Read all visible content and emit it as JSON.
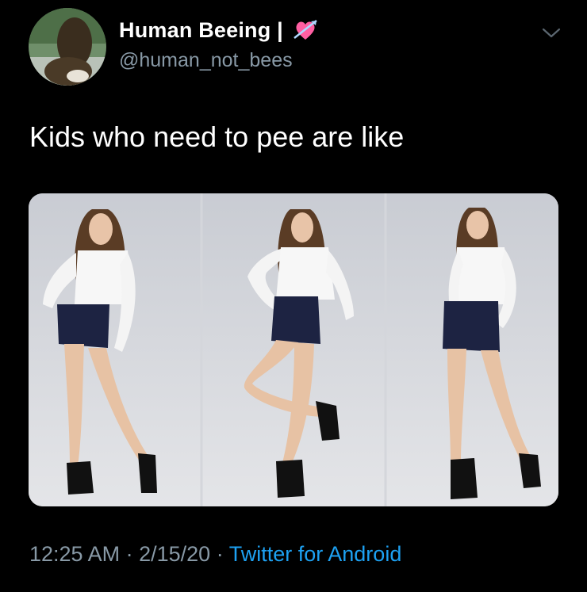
{
  "tweet": {
    "display_name": "Human Beeing |",
    "handle": "@human_not_bees",
    "text": "Kids who need to pee are like",
    "time": "12:25 AM",
    "separator": "·",
    "date": "2/15/20",
    "source": "Twitter for Android"
  },
  "icons": {
    "name_emoji": "heart-with-arrow-icon",
    "menu": "chevron-down-icon"
  },
  "colors": {
    "background": "#000000",
    "text": "#ffffff",
    "secondary_text": "#8899a6",
    "link": "#1da1f2"
  }
}
